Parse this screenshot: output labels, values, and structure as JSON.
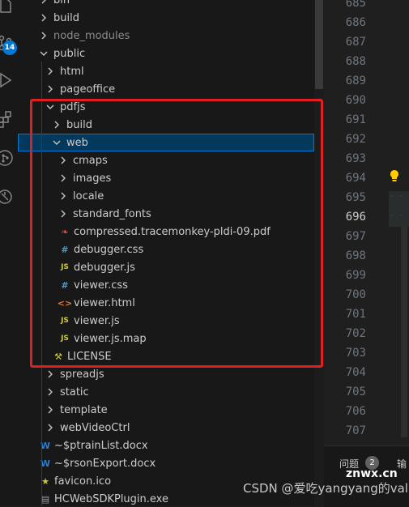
{
  "activity_bar": {
    "items": [
      {
        "name": "explorer-icon"
      },
      {
        "name": "source-control-icon"
      },
      {
        "name": "run-debug-icon"
      },
      {
        "name": "extensions-icon"
      },
      {
        "name": "git-graph-icon"
      },
      {
        "name": "remote-icon"
      }
    ],
    "source_control_badge": "14"
  },
  "explorer": {
    "items": [
      {
        "label": "bin",
        "type": "folder",
        "expanded": false
      },
      {
        "label": "build",
        "type": "folder",
        "expanded": false
      },
      {
        "label": "node_modules",
        "type": "folder",
        "expanded": false,
        "dimmed": true
      },
      {
        "label": "public",
        "type": "folder",
        "expanded": true
      },
      {
        "label": "html",
        "type": "folder",
        "expanded": false
      },
      {
        "label": "pageoffice",
        "type": "folder",
        "expanded": false
      },
      {
        "label": "pdfjs",
        "type": "folder",
        "expanded": true
      },
      {
        "label": "build",
        "type": "folder",
        "expanded": false
      },
      {
        "label": "web",
        "type": "folder",
        "expanded": true,
        "selected": true
      },
      {
        "label": "cmaps",
        "type": "folder",
        "expanded": false
      },
      {
        "label": "images",
        "type": "folder",
        "expanded": false
      },
      {
        "label": "locale",
        "type": "folder",
        "expanded": false
      },
      {
        "label": "standard_fonts",
        "type": "folder",
        "expanded": false
      },
      {
        "label": "compressed.tracemonkey-pldi-09.pdf",
        "type": "pdf"
      },
      {
        "label": "debugger.css",
        "type": "css"
      },
      {
        "label": "debugger.js",
        "type": "js"
      },
      {
        "label": "viewer.css",
        "type": "css"
      },
      {
        "label": "viewer.html",
        "type": "html"
      },
      {
        "label": "viewer.js",
        "type": "js"
      },
      {
        "label": "viewer.js.map",
        "type": "js"
      },
      {
        "label": "LICENSE",
        "type": "license"
      },
      {
        "label": "spreadjs",
        "type": "folder",
        "expanded": false
      },
      {
        "label": "static",
        "type": "folder",
        "expanded": false
      },
      {
        "label": "template",
        "type": "folder",
        "expanded": false
      },
      {
        "label": "webVideoCtrl",
        "type": "folder",
        "expanded": false
      },
      {
        "label": "~$ptrainList.docx",
        "type": "docx"
      },
      {
        "label": "~$rsonExport.docx",
        "type": "docx"
      },
      {
        "label": "favicon.ico",
        "type": "ico"
      },
      {
        "label": "HCWebSDKPlugin.exe",
        "type": "exe"
      }
    ]
  },
  "editor": {
    "line_numbers": [
      "685",
      "686",
      "687",
      "688",
      "689",
      "690",
      "691",
      "692",
      "693",
      "694",
      "695",
      "696",
      "697",
      "698",
      "699",
      "700",
      "701",
      "702",
      "703",
      "704",
      "705",
      "706",
      "707"
    ],
    "current_line": "696"
  },
  "panel": {
    "problems_label": "问题",
    "problems_count": "2",
    "output_label": "输"
  },
  "watermark": {
    "brand": "znwx.cn",
    "text": "CSDN @爱吃yangyang的valu"
  },
  "colors": {
    "accent": "#0078d4",
    "highlight_box": "#e02020",
    "pdf": "#e2483d",
    "css": "#519aba",
    "js": "#cbcb41",
    "html": "#e37933",
    "docx": "#2b7cd3",
    "exe": "#9aa0a6"
  }
}
